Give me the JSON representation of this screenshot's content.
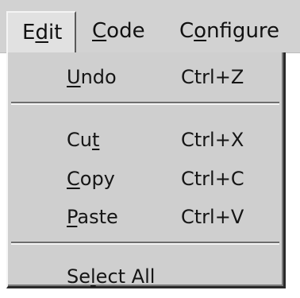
{
  "menubar": {
    "items": [
      {
        "id": "edit",
        "pre": "E",
        "accel": "d",
        "post": "it"
      },
      {
        "id": "code",
        "pre": "",
        "accel": "C",
        "post": "ode"
      },
      {
        "id": "configure",
        "pre": "C",
        "accel": "o",
        "post": "nfigure"
      }
    ]
  },
  "dropdown": {
    "items": [
      {
        "pre": "",
        "accel": "U",
        "post": "ndo",
        "shortcut": "Ctrl+Z"
      },
      {
        "pre": "Cu",
        "accel": "t",
        "post": "",
        "shortcut": "Ctrl+X"
      },
      {
        "pre": "",
        "accel": "C",
        "post": "opy",
        "shortcut": "Ctrl+C"
      },
      {
        "pre": "",
        "accel": "P",
        "post": "aste",
        "shortcut": "Ctrl+V"
      },
      {
        "pre": "Se",
        "accel": "l",
        "post": "ect All",
        "shortcut": ""
      }
    ]
  }
}
